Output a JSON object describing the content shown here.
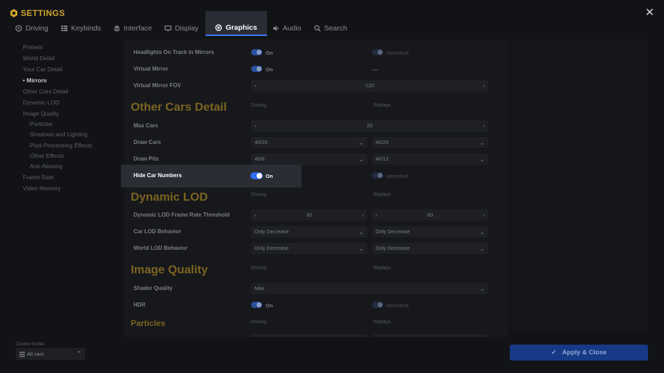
{
  "header": {
    "title": "SETTINGS",
    "close_glyph": "✕"
  },
  "tabs": [
    {
      "label": "Driving",
      "icon": "steering-wheel-icon"
    },
    {
      "label": "Keybinds",
      "icon": "keybinds-icon"
    },
    {
      "label": "Interface",
      "icon": "layers-icon"
    },
    {
      "label": "Display",
      "icon": "monitor-icon"
    },
    {
      "label": "Graphics",
      "icon": "graphics-icon",
      "active": true
    },
    {
      "label": "Audio",
      "icon": "speaker-icon"
    },
    {
      "label": "Search",
      "icon": "search-icon"
    }
  ],
  "nav": [
    {
      "label": "Presets"
    },
    {
      "label": "World Detail"
    },
    {
      "label": "Your Car Detail"
    },
    {
      "label": "Mirrors",
      "active": true,
      "bullet": "•"
    },
    {
      "label": "Other Cars Detail"
    },
    {
      "label": "Dynamic LOD"
    },
    {
      "label": "Image Quality"
    },
    {
      "label": "Particles",
      "sub": true
    },
    {
      "label": "Shadows and Lighting",
      "sub": true
    },
    {
      "label": "Post-Processing Effects",
      "sub": true
    },
    {
      "label": "Other Effects",
      "sub": true
    },
    {
      "label": "Anti-Aliasing",
      "sub": true
    },
    {
      "label": "Frame Rate"
    },
    {
      "label": "Video Memory"
    }
  ],
  "mirrors": {
    "headlights_label": "Headlights On Track in Mirrors",
    "headlights_value": "On",
    "headlights_replay": "Inherited",
    "virtual_mirror_label": "Virtual Mirror",
    "virtual_mirror_value": "On",
    "virtual_mirror_replay": "---",
    "fov_label": "Virtual Mirror FOV",
    "fov_value": "120"
  },
  "other_cars": {
    "title": "Other Cars Detail",
    "col_driving": "Driving",
    "col_replays": "Replays",
    "max_cars_label": "Max Cars",
    "max_cars_value": "20",
    "draw_cars_label": "Draw Cars",
    "draw_cars_driving": "40/20",
    "draw_cars_replays": "40/20",
    "draw_pits_label": "Draw Pits",
    "draw_pits_driving": "40/6",
    "draw_pits_replays": "40/12",
    "hide_numbers_label": "Hide Car Numbers",
    "hide_numbers_value": "On",
    "hide_numbers_replay": "Inherited"
  },
  "dynamic_lod": {
    "title": "Dynamic LOD",
    "col_driving": "Driving",
    "col_replays": "Replays",
    "threshold_label": "Dynamic LOD Frame Rate Threshold",
    "threshold_driving": "30",
    "threshold_replays": "60",
    "car_lod_label": "Car LOD Behavior",
    "car_lod_driving": "Only Decrease",
    "car_lod_replays": "Only Decrease",
    "world_lod_label": "World LOD Behavior",
    "world_lod_driving": "Only Decrease",
    "world_lod_replays": "Only Decrease"
  },
  "image_quality": {
    "title": "Image Quality",
    "col_driving": "Driving",
    "col_replays": "Replays",
    "shader_label": "Shader Quality",
    "shader_value": "Max",
    "hdr_label": "HDR",
    "hdr_value": "On",
    "hdr_replay": "Inherited"
  },
  "particles": {
    "title": "Particles",
    "col_driving": "Driving",
    "col_replays": "Replays"
  },
  "control_profile": {
    "label": "Control Profile",
    "value": "All cars"
  },
  "apply_label": "Apply & Close",
  "colors": {
    "accent_gold": "#d4a62a",
    "accent_blue": "#2f6cf0",
    "apply_bg": "#173a86"
  }
}
